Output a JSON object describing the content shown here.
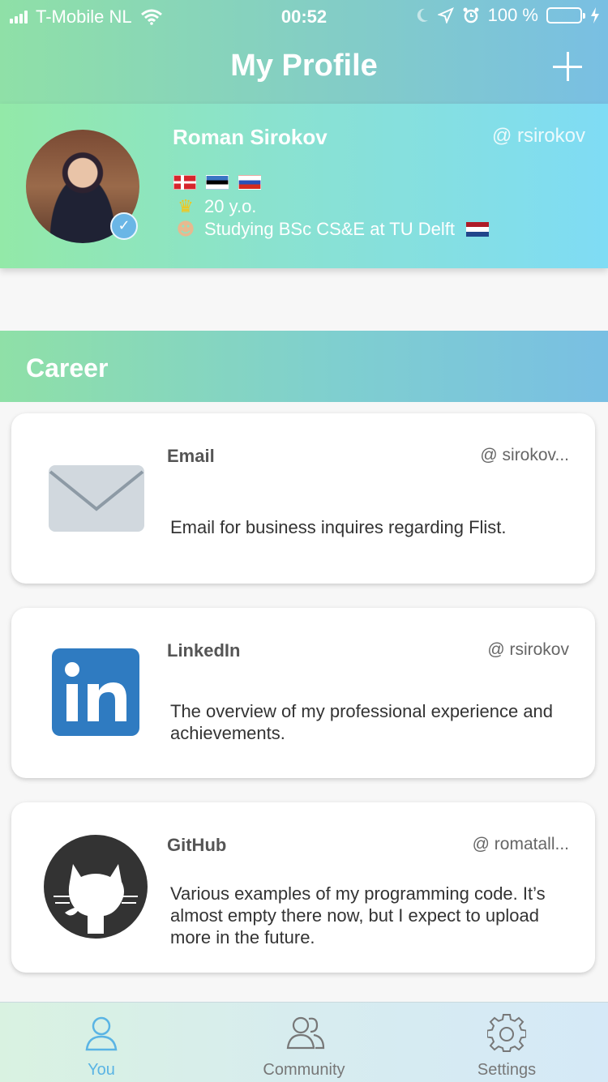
{
  "status_bar": {
    "carrier": "T-Mobile NL",
    "time": "00:52",
    "battery": "100 %",
    "icons": [
      "signal-icon",
      "wifi-icon",
      "moon-icon",
      "location-icon",
      "alarm-icon",
      "battery-icon",
      "charging-icon"
    ]
  },
  "header": {
    "title": "My Profile",
    "add_icon": "plus-icon"
  },
  "profile": {
    "name": "Roman Sirokov",
    "handle": "@ rsirokov",
    "flags": [
      "norway-flag",
      "estonia-flag",
      "russia-flag"
    ],
    "age": "20 y.o.",
    "study": "Studying BSc CS&E at TU Delft",
    "study_flag": "netherlands-flag"
  },
  "section": {
    "title": "Career"
  },
  "cards": [
    {
      "title": "Email",
      "handle": "@ sirokov...",
      "description": "Email for business inquires regarding Flist.",
      "icon": "mail-icon"
    },
    {
      "title": "LinkedIn",
      "handle": "@ rsirokov",
      "description": "The overview of my professional experience and achievements.",
      "icon": "linkedin-icon"
    },
    {
      "title": "GitHub",
      "handle": "@ romatall...",
      "description": "Various examples of my programming code. It’s almost empty there now, but I expect to upload more in the future.",
      "icon": "github-icon"
    }
  ],
  "tabbar": {
    "tabs": [
      {
        "label": "You",
        "icon": "user-icon",
        "active": true
      },
      {
        "label": "Community",
        "icon": "community-icon",
        "active": false
      },
      {
        "label": "Settings",
        "icon": "gear-icon",
        "active": false
      }
    ],
    "active_color": "#5ab4e4",
    "inactive_color": "#777777"
  },
  "colors": {
    "accent_green": "#8fe0a7",
    "accent_blue": "#79bfe3",
    "battery_fill": "#7ee37a"
  }
}
